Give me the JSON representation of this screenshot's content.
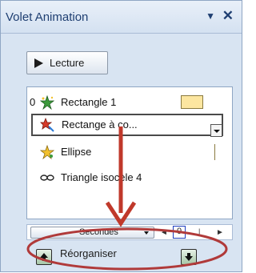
{
  "pane": {
    "title": "Volet Animation",
    "menu_glyph": "▼",
    "close_glyph": "✕"
  },
  "play": {
    "label": "Lecture",
    "icon": "play-icon"
  },
  "animation_list": [
    {
      "number": "0",
      "label": "Rectangle 1",
      "icon": "entrance-effect-icon",
      "timeline_color": "#fce6a0"
    },
    {
      "number": "",
      "label": "Rectange à co...",
      "icon": "motion-path-icon",
      "selected": true
    },
    {
      "number": "",
      "label": "Ellipse",
      "icon": "entrance-effect-icon"
    },
    {
      "number": "",
      "label": "Triangle isocèle 4",
      "icon": "motion-loop-icon"
    }
  ],
  "timebar": {
    "seconds_label": "Secondes",
    "zoom_value": "0",
    "scroll_left": "◄",
    "scroll_right": "►"
  },
  "reorder": {
    "label": "Réorganiser"
  },
  "colors": {
    "pane_bg": "#d8e4f2",
    "annotation_red": "#c0392b",
    "timeline_fill": "#fce6a0"
  }
}
